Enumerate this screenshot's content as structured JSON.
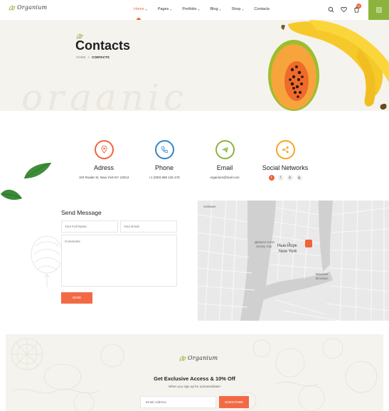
{
  "header": {
    "logo_text": "Organium",
    "nav": [
      {
        "label": "Home",
        "has_dropdown": true,
        "active": true
      },
      {
        "label": "Pages",
        "has_dropdown": true
      },
      {
        "label": "Portfolio",
        "has_dropdown": true
      },
      {
        "label": "Blog",
        "has_dropdown": true
      },
      {
        "label": "Shop",
        "has_dropdown": true
      },
      {
        "label": "Contacts",
        "has_dropdown": false
      }
    ],
    "cart_count": "0",
    "icons": [
      "search-icon",
      "heart-icon",
      "cart-icon",
      "grid-menu-icon"
    ]
  },
  "hero": {
    "title": "Contacts",
    "watermark": "organic",
    "breadcrumb": {
      "home": "HOME",
      "separator": ">",
      "current": "CONTACTS"
    }
  },
  "info": [
    {
      "title": "Adress",
      "value": "103 Roade St, New York NY 10013",
      "color": "#f0643a",
      "icon": "location-pin-icon"
    },
    {
      "title": "Phone",
      "value": "+1 (000) 985 125 478",
      "color": "#2f86c9",
      "icon": "phone-icon"
    },
    {
      "title": "Email",
      "value": "organium@mail.com",
      "color": "#8cb43c",
      "icon": "paper-plane-icon"
    },
    {
      "title": "Social Networks",
      "value": "",
      "color": "#f5a623",
      "icon": "share-icon"
    }
  ],
  "socials": [
    "f",
    "f",
    "in",
    "ig"
  ],
  "form": {
    "title": "Send Message",
    "name_placeholder": "Your Full Name",
    "email_placeholder": "Your Email",
    "comments_placeholder": "Comments",
    "send_label": "SEND"
  },
  "map": {
    "labels": [
      "Хобокен",
      "Джерси-Сити",
      "Jersey City",
      "Нью-Йорк",
      "New York",
      "Бруклин",
      "Brooklyn"
    ]
  },
  "newsletter": {
    "logo_text": "Organium",
    "title": "Get Exclusive Access & 10% Off",
    "subtitle": "When you sign up for ourmewsletter!",
    "email_placeholder": "Email Address",
    "subscribe_label": "SUBSCRIBE"
  },
  "colors": {
    "accent": "#f0643a",
    "green": "#8cb43c",
    "blue": "#2f86c9",
    "yellow": "#f5a623"
  }
}
